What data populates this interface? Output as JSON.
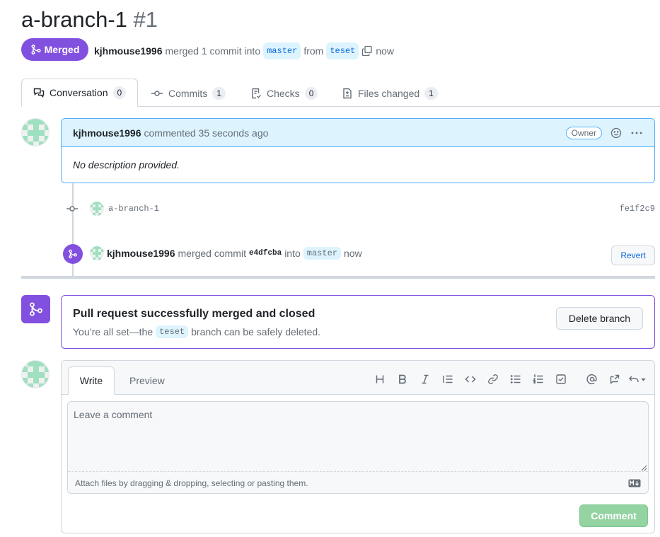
{
  "header": {
    "title": "a-branch-1",
    "number": "#1"
  },
  "status": {
    "badge_label": "Merged",
    "author": "kjhmouse1996",
    "merged_text": "merged 1 commit into",
    "base_branch": "master",
    "from_text": "from",
    "head_branch": "teset",
    "time": "now"
  },
  "tabs": [
    {
      "label": "Conversation",
      "count": "0"
    },
    {
      "label": "Commits",
      "count": "1"
    },
    {
      "label": "Checks",
      "count": "0"
    },
    {
      "label": "Files changed",
      "count": "1"
    }
  ],
  "comment": {
    "author": "kjhmouse1996",
    "action": "commented 35 seconds ago",
    "role_badge": "Owner",
    "body": "No description provided."
  },
  "timeline": {
    "commit_message": "a-branch-1",
    "commit_sha": "fe1f2c9",
    "merge_author": "kjhmouse1996",
    "merge_text": "merged commit",
    "merge_sha": "e4dfcba",
    "into_text": "into",
    "merge_target": "master",
    "merge_time": "now",
    "revert_label": "Revert"
  },
  "merge_box": {
    "title": "Pull request successfully merged and closed",
    "subtitle_pre": "You’re all set—the",
    "branch": "teset",
    "subtitle_post": "branch can be safely deleted.",
    "delete_label": "Delete branch"
  },
  "composer": {
    "write_tab": "Write",
    "preview_tab": "Preview",
    "placeholder": "Leave a comment",
    "attach_text": "Attach files by dragging & dropping, selecting or pasting them.",
    "submit_label": "Comment",
    "toolbar": [
      "heading-icon",
      "bold-icon",
      "italic-icon",
      "quote-icon",
      "code-icon",
      "link-icon",
      "unordered-list-icon",
      "ordered-list-icon",
      "task-list-icon",
      "mention-icon",
      "reference-icon",
      "undo-icon"
    ]
  },
  "colors": {
    "merged_purple": "#8250df",
    "accent_blue": "#0969da",
    "comment_head_bg": "#ddf4ff",
    "disabled_green": "#94d3a2"
  }
}
